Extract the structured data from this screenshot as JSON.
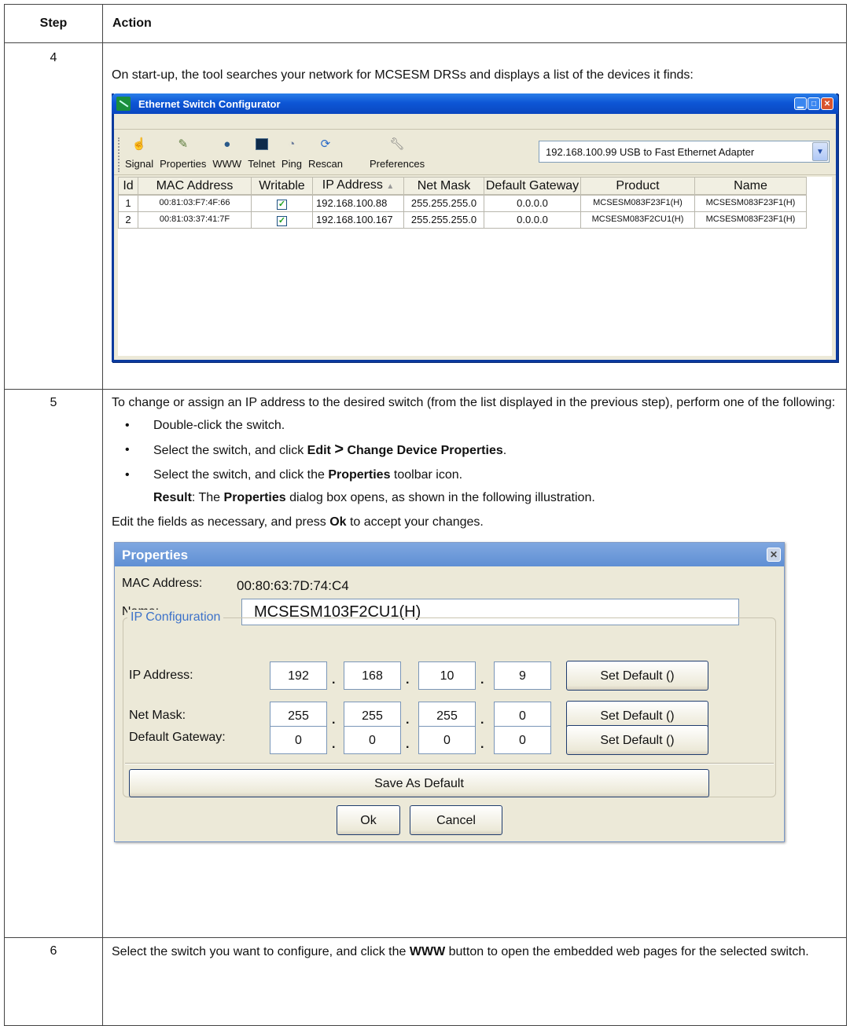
{
  "header": {
    "step": "Step",
    "action": "Action"
  },
  "step4": {
    "number": "4",
    "intro": "On start-up, the tool searches your network for MCSESM DRSs and displays a list of the devices it finds:",
    "window": {
      "title": "Ethernet Switch Configurator",
      "toolbar": [
        {
          "label": "Signal",
          "icon": "hand-icon"
        },
        {
          "label": "Properties",
          "icon": "edit-icon"
        },
        {
          "label": "WWW",
          "icon": "web-icon"
        },
        {
          "label": "Telnet",
          "icon": "terminal-icon"
        },
        {
          "label": "Ping",
          "icon": "ping-icon"
        },
        {
          "label": "Rescan",
          "icon": "refresh-icon"
        },
        {
          "label": "Preferences",
          "icon": "wrench-icon"
        }
      ],
      "adapter": "192.168.100.99 USB to Fast Ethernet Adapter",
      "columns": [
        "Id",
        "MAC Address",
        "Writable",
        "IP Address",
        "Net Mask",
        "Default Gateway",
        "Product",
        "Name"
      ],
      "rows": [
        {
          "id": "1",
          "mac": "00:81:03:F7:4F:66",
          "writable": true,
          "ip": "192.168.100.88",
          "mask": "255.255.255.0",
          "gateway": "0.0.0.0",
          "product": "MCSESM083F23F1(H)",
          "name": "MCSESM083F23F1(H)"
        },
        {
          "id": "2",
          "mac": "00:81:03:37:41:7F",
          "writable": true,
          "ip": "192.168.100.167",
          "mask": "255.255.255.0",
          "gateway": "0.0.0.0",
          "product": "MCSESM083F2CU1(H)",
          "name": "MCSESM083F23F1(H)"
        }
      ]
    }
  },
  "step5": {
    "number": "5",
    "intro": "To change or assign an IP address to the desired switch (from the list displayed in the previous step), perform one of the following:",
    "bullet1": "Double-click the switch.",
    "bullet2_pre": "Select the switch, and click ",
    "bullet2_edit": "Edit",
    "bullet2_arrow": ">",
    "bullet2_cmd": "Change Device Properties",
    "bullet2_post": ".",
    "bullet3_pre": "Select the switch, and click the ",
    "bullet3_bold": "Properties",
    "bullet3_post": " toolbar icon.",
    "result_label": "Result",
    "result_mid": ": The ",
    "result_bold": "Properties",
    "result_post": " dialog box opens, as shown in the following illustration.",
    "edit_pre": "Edit the fields as necessary, and press ",
    "edit_bold": "Ok",
    "edit_post": " to accept your changes.",
    "dialog": {
      "title": "Properties",
      "mac_label": "MAC Address:",
      "mac_value": "00:80:63:7D:74:C4",
      "name_label": "Name:",
      "name_value": "MCSESM103F2CU1(H)",
      "group_title": "IP Configuration",
      "ip_label": "IP Address:",
      "ip": [
        "192",
        "168",
        "10",
        "9"
      ],
      "mask_label": "Net Mask:",
      "mask": [
        "255",
        "255",
        "255",
        "0"
      ],
      "gw_label": "Default Gateway:",
      "gw": [
        "0",
        "0",
        "0",
        "0"
      ],
      "set_default": "Set Default ()",
      "save_default": "Save As Default",
      "ok": "Ok",
      "cancel": "Cancel"
    }
  },
  "step6": {
    "number": "6",
    "pre": "Select the switch you want to configure, and click the ",
    "bold": "WWW",
    "post": " button to open the embedded web pages for the selected switch."
  }
}
